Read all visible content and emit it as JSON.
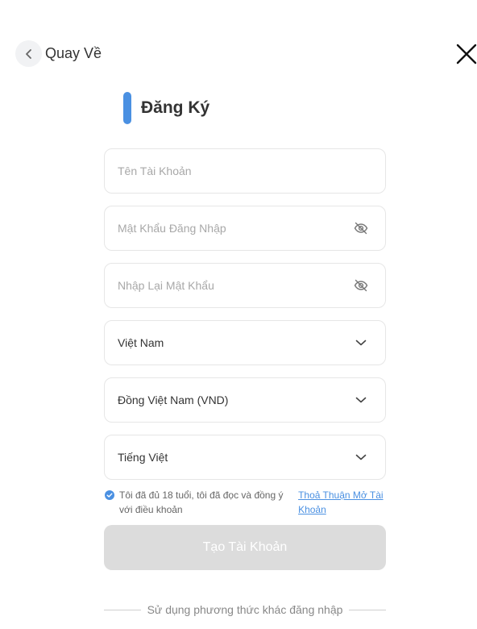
{
  "header": {
    "back_label": "Quay Về",
    "title": "Đăng Ký"
  },
  "form": {
    "username_placeholder": "Tên Tài Khoản",
    "password_placeholder": "Mật Khẩu Đăng Nhập",
    "confirm_password_placeholder": "Nhập Lại Mật Khẩu",
    "country_value": "Việt Nam",
    "currency_value": "Đồng Việt Nam (VND)",
    "language_value": "Tiếng Việt"
  },
  "agreement": {
    "checked": true,
    "text": "Tôi đã đủ 18 tuổi, tôi đã đọc và đồng ý với điều khoản",
    "link": "Thoả Thuận Mở Tài Khoản"
  },
  "submit_label": "Tạo Tài Khoản",
  "other_login_label": "Sử dụng phương thức khác đăng nhập",
  "colors": {
    "accent": "#4a90e2",
    "button_disabled": "#dcdcdc",
    "placeholder": "#a8a8a8"
  },
  "icons": {
    "back": "chevron-left-icon",
    "close": "close-icon",
    "password_toggle": "eye-off-icon",
    "dropdown": "chevron-down-icon",
    "check": "check-circle-icon"
  }
}
